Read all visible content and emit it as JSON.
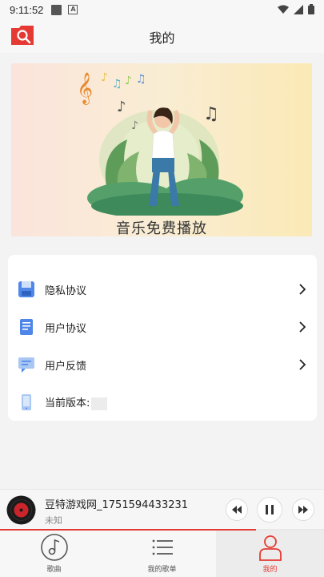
{
  "status_bar": {
    "time": "9:11:52"
  },
  "header": {
    "title": "我的"
  },
  "banner": {
    "caption": "音乐免费播放"
  },
  "menu": {
    "items": [
      {
        "label": "隐私协议",
        "icon": "privacy-icon",
        "has_arrow": true
      },
      {
        "label": "用户协议",
        "icon": "agreement-icon",
        "has_arrow": true
      },
      {
        "label": "用户反馈",
        "icon": "feedback-icon",
        "has_arrow": true
      },
      {
        "label": "当前版本:",
        "icon": "phone-icon",
        "has_arrow": false
      }
    ]
  },
  "player": {
    "track_title": "豆特游戏网_1751594433231",
    "artist": "未知",
    "progress": 0.79
  },
  "bottom_nav": {
    "items": [
      {
        "label": "歌曲",
        "icon": "music-note-icon",
        "active": false
      },
      {
        "label": "我的歌单",
        "icon": "playlist-icon",
        "active": false
      },
      {
        "label": "我的",
        "icon": "user-icon",
        "active": true
      }
    ]
  },
  "colors": {
    "accent": "#e53a33",
    "menu_icon": "#4f86e8"
  }
}
